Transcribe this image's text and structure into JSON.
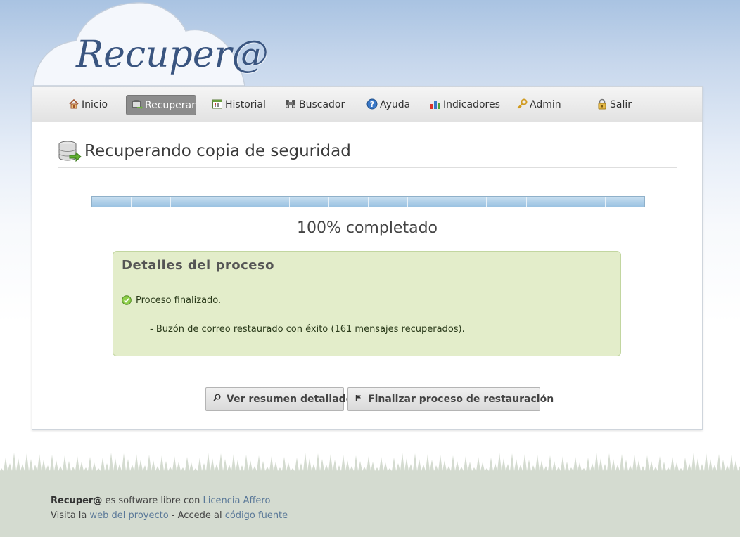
{
  "app": {
    "logo_text": "Recuper@"
  },
  "nav": {
    "items": [
      {
        "label": "Inicio",
        "icon": "home-icon",
        "active": false
      },
      {
        "label": "Recuperar",
        "icon": "database-restore-icon",
        "active": true
      },
      {
        "label": "Historial",
        "icon": "calendar-icon",
        "active": false
      },
      {
        "label": "Buscador",
        "icon": "binoculars-icon",
        "active": false
      },
      {
        "label": "Ayuda",
        "icon": "help-icon",
        "active": false
      },
      {
        "label": "Indicadores",
        "icon": "bar-chart-icon",
        "active": false
      },
      {
        "label": "Admin",
        "icon": "key-icon",
        "active": false
      },
      {
        "label": "Salir",
        "icon": "lock-icon",
        "active": false
      }
    ]
  },
  "page": {
    "title": "Recuperando copia de seguridad",
    "title_icon": "database-restore-icon"
  },
  "progress": {
    "fraction": 1.0,
    "segments": 14,
    "label": "100% completado"
  },
  "details": {
    "heading": "Detalles del proceso",
    "status": "Proceso finalizado.",
    "status_icon": "check-circle-icon",
    "message": "- Buzón de correo restaurado con éxito (161 mensajes recuperados)."
  },
  "buttons": {
    "summary": {
      "label": "Ver resumen detallado",
      "icon": "search-icon"
    },
    "finish": {
      "label": "Finalizar proceso de restauración",
      "icon": "flag-icon"
    }
  },
  "footer": {
    "line1": {
      "brand": "Recuper@",
      "text": " es software libre con ",
      "link": "Licencia Affero"
    },
    "line2": {
      "text1": "Visita la ",
      "link1": "web del proyecto",
      "text2": " - Accede al ",
      "link2": "código fuente"
    }
  },
  "colors": {
    "accent": "#3a5580",
    "panel_success": "#e3edca",
    "progress": "#9ac2e2",
    "link": "#5a7898"
  }
}
